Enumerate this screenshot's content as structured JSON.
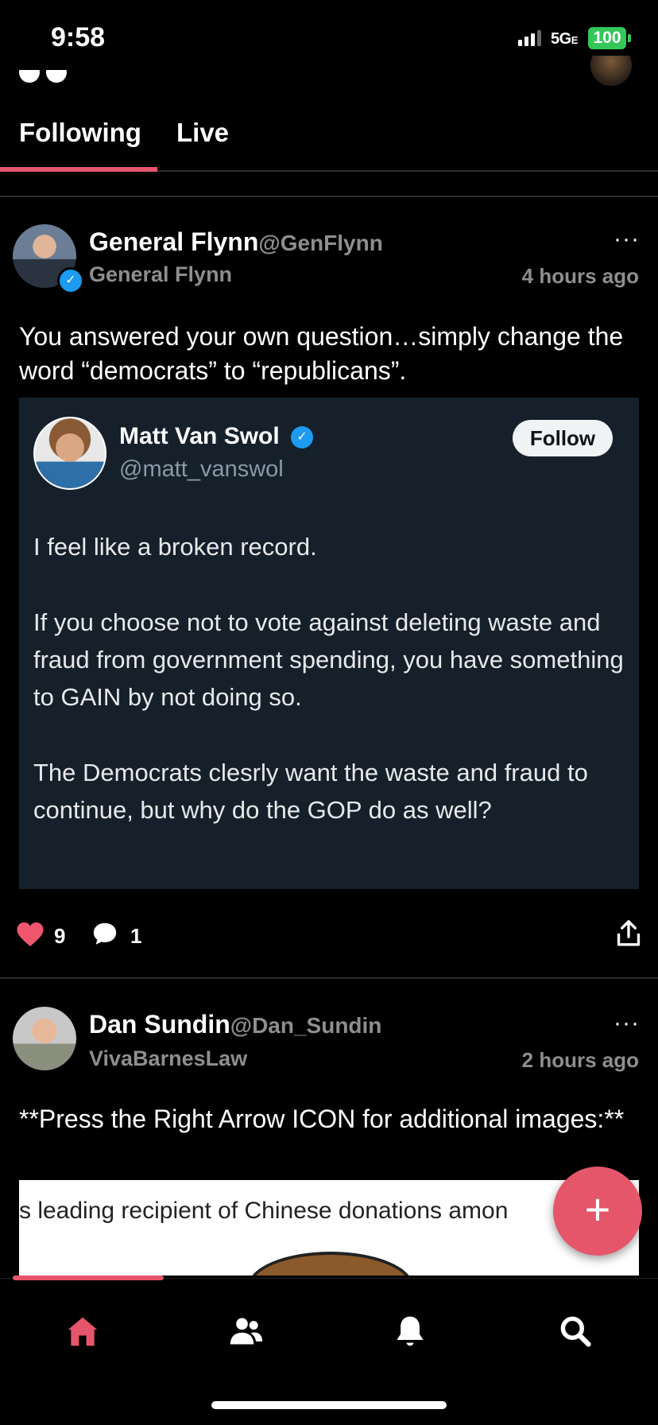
{
  "status_bar": {
    "time": "9:58",
    "network": "5G",
    "network_suffix": "E",
    "battery": "100"
  },
  "tabs": [
    {
      "label": "Following",
      "active": true
    },
    {
      "label": "Live",
      "active": false
    }
  ],
  "posts": [
    {
      "display_name": "General Flynn",
      "handle": "@GenFlynn",
      "subtitle": "General Flynn",
      "time_ago": "4 hours ago",
      "text": "You answered your own question…simply change the word “democrats” to “republicans”.",
      "embed": {
        "name": "Matt Van Swol",
        "handle": "@matt_vanswol",
        "follow_label": "Follow",
        "paragraphs": [
          "I feel like a broken record.",
          "If you choose not to vote against deleting waste and fraud from government spending, you have something to GAIN by not doing so.",
          "The Democrats clesrly want the waste and fraud to continue, but why do the GOP do as well?"
        ]
      },
      "likes": "9",
      "comments": "1"
    },
    {
      "display_name": "Dan Sundin",
      "handle": "@Dan_Sundin",
      "subtitle": "VivaBarnesLaw",
      "time_ago": "2 hours ago",
      "text": "**Press the Right Arrow ICON for additional images:**",
      "image_text": "s leading recipient of Chinese donations amon"
    }
  ],
  "fab": {
    "label": "+"
  },
  "nav": {
    "items": [
      {
        "icon": "home-icon",
        "active": true
      },
      {
        "icon": "people-icon",
        "active": false
      },
      {
        "icon": "bell-icon",
        "active": false
      },
      {
        "icon": "search-icon",
        "active": false
      }
    ]
  },
  "colors": {
    "accent": "#e5566a",
    "card": "#15202b",
    "verified": "#1d9bf0"
  }
}
